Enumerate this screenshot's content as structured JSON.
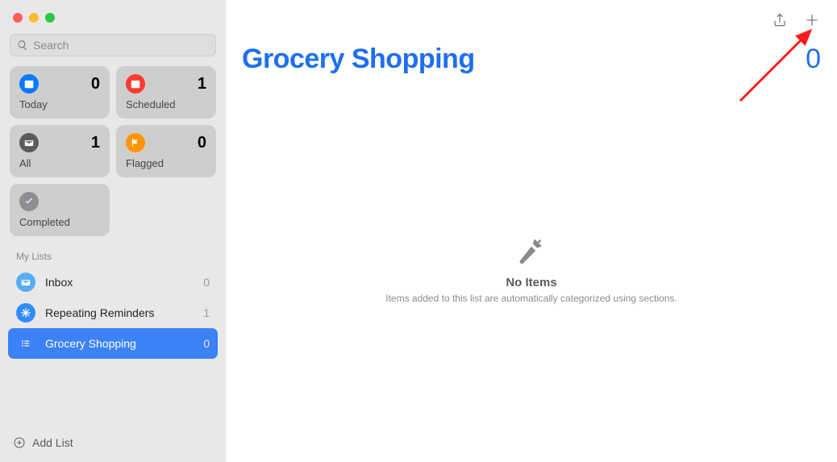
{
  "search": {
    "placeholder": "Search"
  },
  "smart": {
    "today": {
      "label": "Today",
      "count": "0"
    },
    "scheduled": {
      "label": "Scheduled",
      "count": "1"
    },
    "all": {
      "label": "All",
      "count": "1"
    },
    "flagged": {
      "label": "Flagged",
      "count": "0"
    },
    "completed": {
      "label": "Completed"
    }
  },
  "sectionLabel": "My Lists",
  "lists": [
    {
      "name": "Inbox",
      "count": "0"
    },
    {
      "name": "Repeating Reminders",
      "count": "1"
    },
    {
      "name": "Grocery Shopping",
      "count": "0"
    }
  ],
  "addList": "Add List",
  "main": {
    "title": "Grocery Shopping",
    "count": "0",
    "emptyHeading": "No Items",
    "emptySub": "Items added to this list are automatically categorized using sections."
  }
}
